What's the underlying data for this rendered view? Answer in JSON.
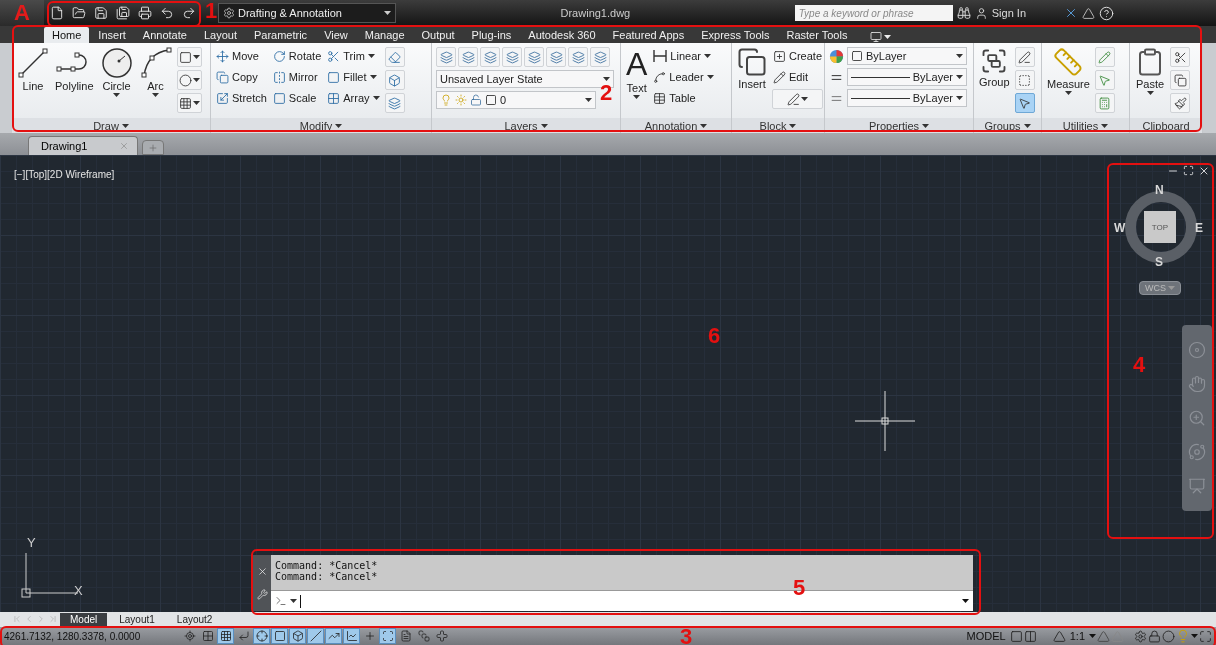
{
  "title_bar": {
    "app_logo": "A",
    "workspace": "Drafting & Annotation",
    "title": "Drawing1.dwg",
    "search_placeholder": "Type a keyword or phrase",
    "sign_in": "Sign In"
  },
  "ribbon_tabs": [
    {
      "label": "Home",
      "selected": true
    },
    {
      "label": "Insert",
      "selected": false
    },
    {
      "label": "Annotate",
      "selected": false
    },
    {
      "label": "Layout",
      "selected": false
    },
    {
      "label": "Parametric",
      "selected": false
    },
    {
      "label": "View",
      "selected": false
    },
    {
      "label": "Manage",
      "selected": false
    },
    {
      "label": "Output",
      "selected": false
    },
    {
      "label": "Plug-ins",
      "selected": false
    },
    {
      "label": "Autodesk 360",
      "selected": false
    },
    {
      "label": "Featured Apps",
      "selected": false
    },
    {
      "label": "Express Tools",
      "selected": false
    },
    {
      "label": "Raster Tools",
      "selected": false
    }
  ],
  "draw_panel": {
    "title": "Draw",
    "tools": [
      {
        "label": "Line",
        "dropdown": false
      },
      {
        "label": "Polyline",
        "dropdown": false
      },
      {
        "label": "Circle",
        "dropdown": true
      },
      {
        "label": "Arc",
        "dropdown": true
      }
    ]
  },
  "modify_panel": {
    "title": "Modify",
    "tools": [
      {
        "label": "Move",
        "dropdown": false
      },
      {
        "label": "Copy",
        "dropdown": false
      },
      {
        "label": "Stretch",
        "dropdown": false
      },
      {
        "label": "Rotate",
        "dropdown": false
      },
      {
        "label": "Mirror",
        "dropdown": false
      },
      {
        "label": "Scale",
        "dropdown": false
      },
      {
        "label": "Trim",
        "dropdown": true
      },
      {
        "label": "Fillet",
        "dropdown": true
      },
      {
        "label": "Array",
        "dropdown": true
      }
    ]
  },
  "layers_panel": {
    "title": "Layers",
    "layer_state": "Unsaved Layer State",
    "current_layer": "0"
  },
  "annotation_panel": {
    "title": "Annotation",
    "text_icon": "A",
    "main_tool": "Text",
    "tools": [
      {
        "label": "Linear",
        "dropdown": true
      },
      {
        "label": "Leader",
        "dropdown": true
      },
      {
        "label": "Table",
        "dropdown": false
      }
    ]
  },
  "block_panel": {
    "title": "Block",
    "main_tool": "Insert",
    "tools": [
      {
        "label": "Create"
      },
      {
        "label": "Edit"
      }
    ]
  },
  "properties_panel": {
    "title": "Properties",
    "color_setting": "ByLayer",
    "lineweight": "ByLayer",
    "linetype": "ByLayer"
  },
  "groups_panel": {
    "title": "Groups",
    "main_tool": "Group",
    "icon_buttons": [
      {
        "on": false
      },
      {
        "on": false
      },
      {
        "on": true
      }
    ]
  },
  "utilities_panel": {
    "title": "Utilities",
    "main_tool": "Measure"
  },
  "clipboard_panel": {
    "title": "Clipboard",
    "main_tool": "Paste"
  },
  "document_tabs": [
    {
      "label": "Drawing1",
      "selected": true
    }
  ],
  "viewport": {
    "label": "[−][Top][2D Wireframe]",
    "ucs": {
      "x": "X",
      "y": "Y"
    }
  },
  "view_cube": {
    "north": "N",
    "west": "W",
    "east": "E",
    "south": "S",
    "face": "TOP",
    "ucs_menu": "WCS"
  },
  "command_line": {
    "history": [
      "Command: *Cancel*",
      "Command: *Cancel*"
    ]
  },
  "layout_tabs": [
    {
      "label": "Model",
      "selected": true
    },
    {
      "label": "Layout1",
      "selected": false
    },
    {
      "label": "Layout2",
      "selected": false
    }
  ],
  "status_bar": {
    "coordinates": "4261.7132, 1280.3378, 0.0000",
    "toggles": [
      {
        "on": false
      },
      {
        "on": false
      },
      {
        "on": true
      },
      {
        "on": false
      },
      {
        "on": true
      },
      {
        "on": true
      },
      {
        "on": true
      },
      {
        "on": true
      },
      {
        "on": true
      },
      {
        "on": true
      },
      {
        "on": false
      },
      {
        "on": true
      },
      {
        "on": false
      },
      {
        "on": false
      },
      {
        "on": false
      }
    ],
    "space": "MODEL",
    "scale": "1:1"
  },
  "annotations": [
    {
      "label": "1",
      "boxed": true
    },
    {
      "label": "2",
      "boxed": true
    },
    {
      "label": "3",
      "boxed": true
    },
    {
      "label": "4",
      "boxed": true
    },
    {
      "label": "5",
      "boxed": true
    },
    {
      "label": "6",
      "boxed": false
    }
  ]
}
